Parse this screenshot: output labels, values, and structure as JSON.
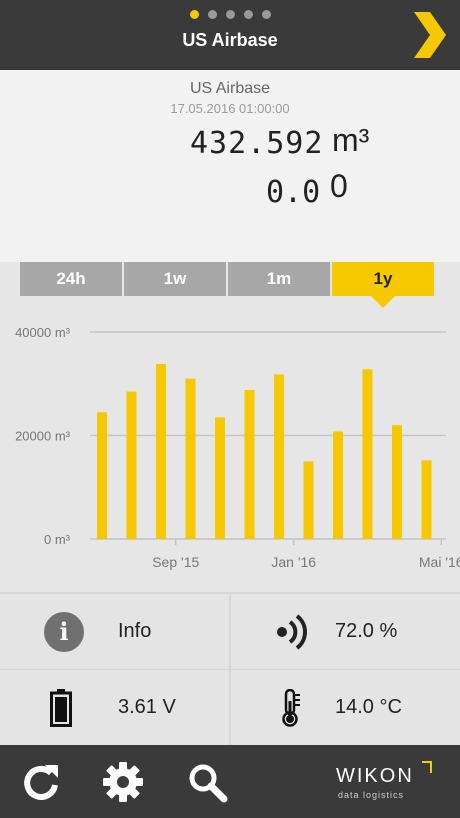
{
  "header": {
    "title": "US Airbase",
    "page_count": 5,
    "active_page": 1,
    "next_icon": "chevron-right-icon"
  },
  "readout": {
    "device_name": "US Airbase",
    "timestamp": "17.05.2016 01:00:00",
    "volume_value": "432.592",
    "volume_unit": "m³",
    "flow_value": "0.0",
    "flow_extra": "0"
  },
  "tabs": [
    {
      "label": "24h",
      "active": false
    },
    {
      "label": "1w",
      "active": false
    },
    {
      "label": "1m",
      "active": false
    },
    {
      "label": "1y",
      "active": true
    }
  ],
  "chart_data": {
    "type": "bar",
    "title": "",
    "xlabel": "",
    "ylabel": "",
    "unit": "m³",
    "ylim": [
      0,
      40000
    ],
    "y_ticks": [
      "0 m³",
      "20000 m³",
      "40000 m³"
    ],
    "y_tick_values": [
      0,
      20000,
      40000
    ],
    "x_tick_labels": [
      "Sep '15",
      "Jan '16",
      "Mai '16"
    ],
    "x_tick_positions": [
      2.5,
      6.5,
      11.5
    ],
    "values": [
      24500,
      28500,
      33800,
      31000,
      23500,
      28800,
      31800,
      15000,
      20800,
      32800,
      22000,
      15200
    ],
    "bar_color": "#f5c800",
    "grid": true
  },
  "grid": {
    "info_label": "Info",
    "signal_value": "72.0 %",
    "battery_value": "3.61 V",
    "temperature_value": "14.0 °C",
    "info_icon_glyph": "i"
  },
  "footer": {
    "logo_name": "WIKON",
    "logo_sub": "data logistics"
  },
  "colors": {
    "accent": "#f5c800",
    "header_bg": "#3a3a3a"
  }
}
